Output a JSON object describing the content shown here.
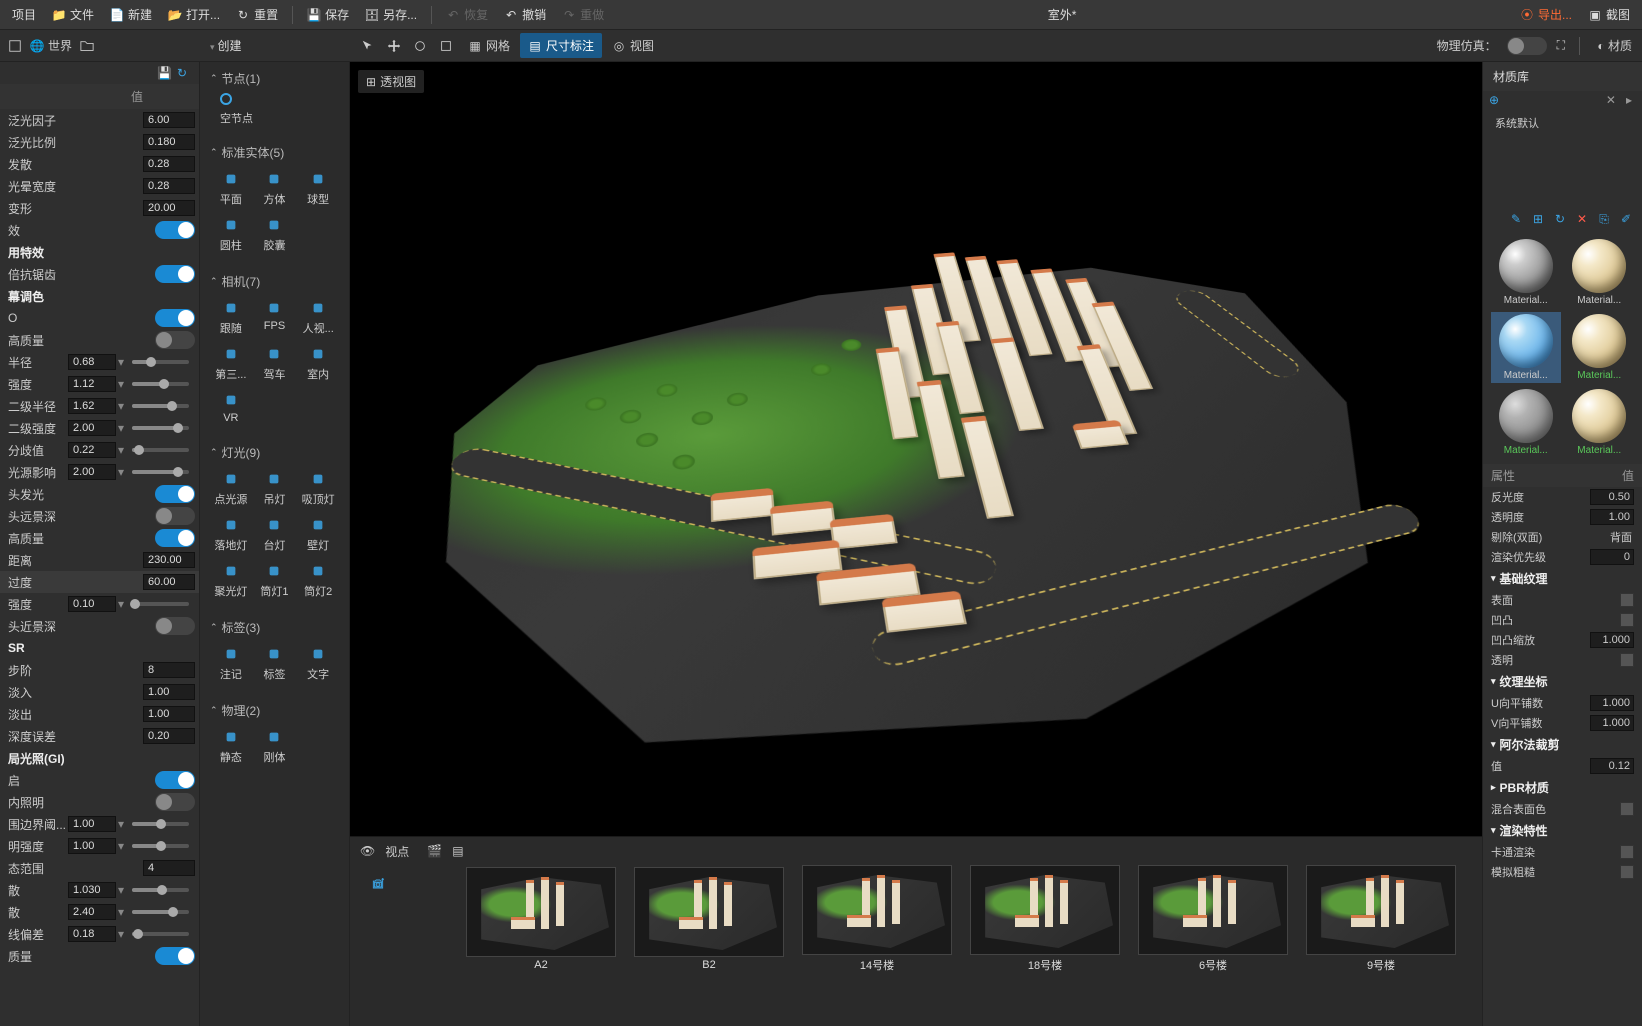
{
  "toolbar": {
    "project": "项目",
    "file": "文件",
    "new": "新建",
    "open": "打开...",
    "reset": "重置",
    "save": "保存",
    "saveas": "另存...",
    "recover": "恢复",
    "undo": "撤销",
    "redo": "重做",
    "title": "室外*",
    "export": "导出...",
    "screenshot": "截图"
  },
  "row2": {
    "world": "世界",
    "create": "创建",
    "tabs": [
      "网格",
      "尺寸标注",
      "视图"
    ],
    "physics": "物理仿真："
  },
  "materialHeader": "材质",
  "left": {
    "headerVal": "值",
    "rows": [
      {
        "type": "vs",
        "label": "泛光因子",
        "value": "6.00"
      },
      {
        "type": "vs",
        "label": "泛光比例",
        "value": "0.180"
      },
      {
        "type": "vs",
        "label": "发散",
        "value": "0.28"
      },
      {
        "type": "vs",
        "label": "光晕宽度",
        "value": "0.28"
      },
      {
        "type": "vs",
        "label": "变形",
        "value": "20.00"
      },
      {
        "type": "tog",
        "label": "效",
        "on": true
      },
      {
        "type": "sec",
        "label": "用特效"
      },
      {
        "type": "tog",
        "label": "倍抗锯齿",
        "on": true
      },
      {
        "type": "sec",
        "label": "幕调色"
      },
      {
        "type": "tog",
        "label": "O",
        "on": true
      },
      {
        "type": "tog",
        "label": "高质量",
        "on": false
      },
      {
        "type": "vsl",
        "label": "半径",
        "value": "0.68",
        "pct": 34
      },
      {
        "type": "vsl",
        "label": "强度",
        "value": "1.12",
        "pct": 56
      },
      {
        "type": "vsl",
        "label": "二级半径",
        "value": "1.62",
        "pct": 70
      },
      {
        "type": "vsl",
        "label": "二级强度",
        "value": "2.00",
        "pct": 80
      },
      {
        "type": "vsl",
        "label": "分歧值",
        "value": "0.22",
        "pct": 12
      },
      {
        "type": "vsl",
        "label": "光源影响",
        "value": "2.00",
        "pct": 80
      },
      {
        "type": "tog",
        "label": "头发光",
        "on": true
      },
      {
        "type": "tog",
        "label": "头远景深",
        "on": false
      },
      {
        "type": "tog",
        "label": "高质量",
        "on": true
      },
      {
        "type": "vs",
        "label": "距离",
        "value": "230.00"
      },
      {
        "type": "vs",
        "label": "过度",
        "value": "60.00",
        "hl": true
      },
      {
        "type": "vsl",
        "label": "强度",
        "value": "0.10",
        "pct": 6
      },
      {
        "type": "tog",
        "label": "头近景深",
        "on": false
      },
      {
        "type": "sec",
        "label": "SR"
      },
      {
        "type": "vs",
        "label": "步阶",
        "value": "8"
      },
      {
        "type": "vs",
        "label": "淡入",
        "value": "1.00"
      },
      {
        "type": "vs",
        "label": "淡出",
        "value": "1.00"
      },
      {
        "type": "vs",
        "label": "深度误差",
        "value": "0.20"
      },
      {
        "type": "sec",
        "label": "局光照(GI)"
      },
      {
        "type": "tog",
        "label": "启",
        "on": true
      },
      {
        "type": "tog",
        "label": "内照明",
        "on": false
      },
      {
        "type": "vsl",
        "label": "围边界阈...",
        "value": "1.00",
        "pct": 50
      },
      {
        "type": "vsl",
        "label": "明强度",
        "value": "1.00",
        "pct": 50
      },
      {
        "type": "vs",
        "label": "态范围",
        "value": "4"
      },
      {
        "type": "vsl",
        "label": "散",
        "value": "1.030",
        "pct": 52
      },
      {
        "type": "vsl",
        "label": "散",
        "value": "2.40",
        "pct": 72
      },
      {
        "type": "vsl",
        "label": "线偏差",
        "value": "0.18",
        "pct": 10
      },
      {
        "type": "tog",
        "label": "质量",
        "on": true
      }
    ]
  },
  "create": {
    "groups": [
      {
        "name": "节点(1)",
        "kind": "node",
        "items": [
          {
            "label": "空节点"
          }
        ]
      },
      {
        "name": "标准实体(5)",
        "items": [
          {
            "label": "平面",
            "icon": "plane"
          },
          {
            "label": "方体",
            "icon": "cube"
          },
          {
            "label": "球型",
            "icon": "sphere"
          },
          {
            "label": "圆柱",
            "icon": "cylinder"
          },
          {
            "label": "胶囊",
            "icon": "capsule"
          }
        ]
      },
      {
        "name": "相机(7)",
        "items": [
          {
            "label": "跟随",
            "icon": "target"
          },
          {
            "label": "FPS",
            "icon": "crosshair"
          },
          {
            "label": "人视...",
            "icon": "person"
          },
          {
            "label": "第三...",
            "icon": "walk"
          },
          {
            "label": "驾车",
            "icon": "car"
          },
          {
            "label": "室内",
            "icon": "house"
          },
          {
            "label": "VR",
            "icon": "vr"
          }
        ]
      },
      {
        "name": "灯光(9)",
        "items": [
          {
            "label": "点光源",
            "icon": "bulb"
          },
          {
            "label": "吊灯",
            "icon": "pendant"
          },
          {
            "label": "吸顶灯",
            "icon": "ceiling"
          },
          {
            "label": "落地灯",
            "icon": "floor"
          },
          {
            "label": "台灯",
            "icon": "desk"
          },
          {
            "label": "壁灯",
            "icon": "wall"
          },
          {
            "label": "聚光灯",
            "icon": "spot"
          },
          {
            "label": "筒灯1",
            "icon": "down1"
          },
          {
            "label": "筒灯2",
            "icon": "down2"
          }
        ]
      },
      {
        "name": "标签(3)",
        "items": [
          {
            "label": "注记",
            "icon": "note"
          },
          {
            "label": "标签",
            "icon": "tag"
          },
          {
            "label": "文字",
            "icon": "text"
          }
        ]
      },
      {
        "name": "物理(2)",
        "items": [
          {
            "label": "静态",
            "icon": "static"
          },
          {
            "label": "刚体",
            "icon": "rigid"
          }
        ]
      }
    ]
  },
  "viewport": {
    "badge": "透视图"
  },
  "viewpoints": {
    "label": "视点",
    "items": [
      "A2",
      "B2",
      "14号楼",
      "18号楼",
      "6号楼",
      "9号楼"
    ]
  },
  "right": {
    "lib": "材质库",
    "sysdefault": "系统默认",
    "materials": [
      {
        "name": "Material...",
        "ball": "grey"
      },
      {
        "name": "Material...",
        "ball": "beige"
      },
      {
        "name": "Material...",
        "ball": "blue",
        "sel": true
      },
      {
        "name": "Material...",
        "ball": "beige",
        "green": true
      },
      {
        "name": "Material...",
        "ball": "rough",
        "green": true
      },
      {
        "name": "Material...",
        "ball": "beige",
        "green": true
      }
    ],
    "propHeader": {
      "c1": "属性",
      "c2": "值"
    },
    "props": [
      {
        "t": "nv",
        "label": "反光度",
        "value": "0.50"
      },
      {
        "t": "nv",
        "label": "透明度",
        "value": "1.00"
      },
      {
        "t": "tx",
        "label": "剔除(双面)",
        "value": "背面"
      },
      {
        "t": "nv",
        "label": "渲染优先级",
        "value": "0"
      },
      {
        "t": "g",
        "label": "基础纹理"
      },
      {
        "t": "ch",
        "label": "表面"
      },
      {
        "t": "ch",
        "label": "凹凸"
      },
      {
        "t": "nv",
        "label": "凹凸缩放",
        "value": "1.000"
      },
      {
        "t": "ch",
        "label": "透明"
      },
      {
        "t": "g",
        "label": "纹理坐标"
      },
      {
        "t": "nv",
        "label": "U向平铺数",
        "value": "1.000"
      },
      {
        "t": "nv",
        "label": "V向平铺数",
        "value": "1.000"
      },
      {
        "t": "g",
        "label": "阿尔法裁剪"
      },
      {
        "t": "nv",
        "label": "值",
        "value": "0.12"
      },
      {
        "t": "g",
        "label": "PBR材质",
        "closed": true
      },
      {
        "t": "ch",
        "label": "混合表面色"
      },
      {
        "t": "g",
        "label": "渲染特性"
      },
      {
        "t": "ch",
        "label": "卡通渲染"
      },
      {
        "t": "ch",
        "label": "模拟粗糙"
      }
    ]
  }
}
